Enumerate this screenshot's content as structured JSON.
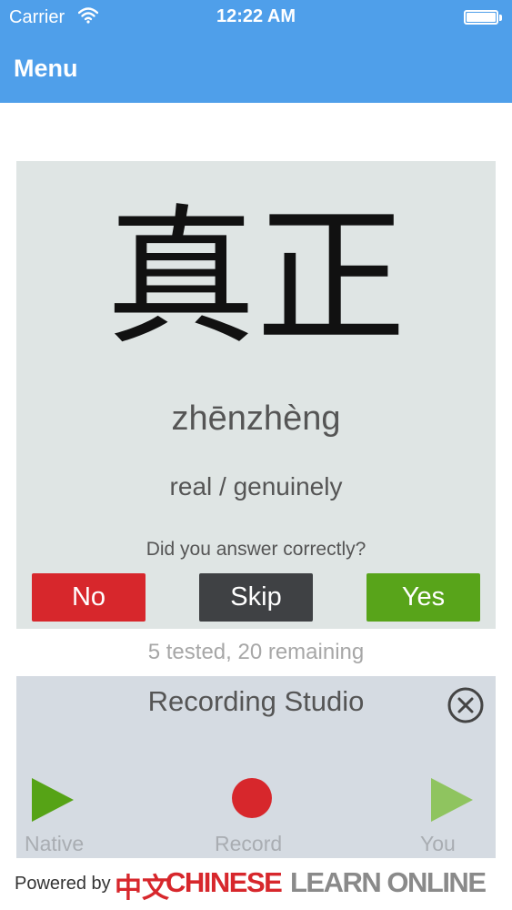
{
  "status_bar": {
    "carrier": "Carrier",
    "time": "12:22 AM"
  },
  "nav": {
    "menu_label": "Menu"
  },
  "card": {
    "hanzi": "真正",
    "pinyin": "zhēnzhèng",
    "meaning": "real / genuinely",
    "question": "Did you answer correctly?",
    "buttons": {
      "no": "No",
      "skip": "Skip",
      "yes": "Yes"
    }
  },
  "progress_text": "5 tested, 20 remaining",
  "studio": {
    "title": "Recording Studio",
    "native_label": "Native",
    "record_label": "Record",
    "you_label": "You"
  },
  "footer": {
    "powered_by": "Powered by",
    "logo_cn": "中文",
    "logo_word1": "CHINESE",
    "logo_word2": "LEARN ONLINE"
  },
  "colors": {
    "header": "#4f9fea",
    "no": "#d7272c",
    "skip": "#3f4144",
    "yes": "#58a41a",
    "record": "#d7272c",
    "native_play": "#56a316",
    "you_play": "#8fc45f"
  }
}
